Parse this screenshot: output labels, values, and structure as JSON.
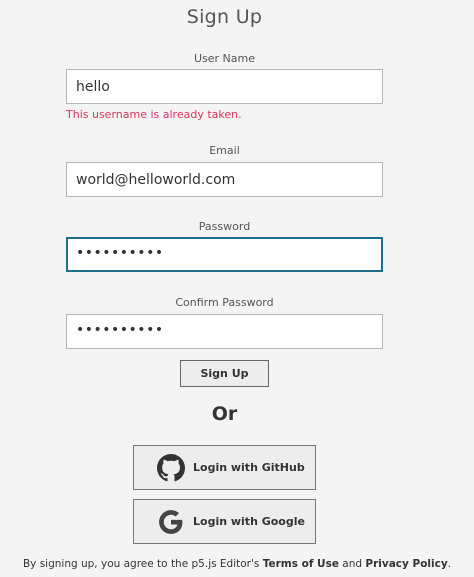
{
  "form": {
    "title": "Sign Up",
    "username": {
      "label": "User Name",
      "value": "hello",
      "error": "This username is already taken."
    },
    "email": {
      "label": "Email",
      "value": "world@helloworld.com"
    },
    "password": {
      "label": "Password",
      "masked": "••••••••••"
    },
    "confirm_password": {
      "label": "Confirm Password",
      "masked": "••••••••••"
    },
    "submit_label": "Sign Up"
  },
  "divider_text": "Or",
  "oauth": {
    "github_label": "Login with GitHub",
    "google_label": "Login with Google"
  },
  "footer": {
    "prefix": "By signing up, you agree to the p5.js Editor's ",
    "terms_label": "Terms of Use",
    "conjunction": " and ",
    "privacy_label": "Privacy Policy",
    "suffix": "."
  }
}
